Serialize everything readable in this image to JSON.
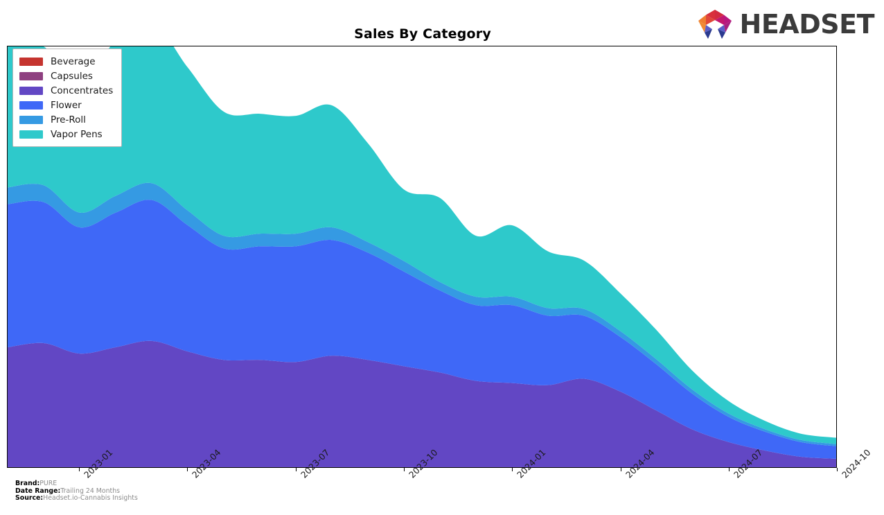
{
  "header": {
    "title": "Sales By Category",
    "logo_text": "HEADSET",
    "logo_icon": "headset-arch-logo"
  },
  "footnotes": [
    {
      "key": "Brand:",
      "value": "PURE"
    },
    {
      "key": "Date Range:",
      "value": "Trailing 24 Months"
    },
    {
      "key": "Source:",
      "value": "Headset.io-Cannabis Insights"
    }
  ],
  "legend": {
    "position": "top-left",
    "items": [
      {
        "label": "Beverage",
        "color": "#c5342f"
      },
      {
        "label": "Capsules",
        "color": "#8e4080"
      },
      {
        "label": "Concentrates",
        "color": "#6247c4"
      },
      {
        "label": "Flower",
        "color": "#3f68f7"
      },
      {
        "label": "Pre-Roll",
        "color": "#359ae3"
      },
      {
        "label": "Vapor Pens",
        "color": "#2ec9cb"
      }
    ]
  },
  "chart_data": {
    "type": "area",
    "title": "Sales By Category",
    "xlabel": "",
    "ylabel": "",
    "stacked": true,
    "grid": false,
    "legend_position": "upper left",
    "axis_tick_labels": [
      "2023-01",
      "2023-04",
      "2023-07",
      "2023-10",
      "2024-01",
      "2024-04",
      "2024-07",
      "2024-10"
    ],
    "x": [
      "2022-11",
      "2022-12",
      "2023-01",
      "2023-02",
      "2023-03",
      "2023-04",
      "2023-05",
      "2023-06",
      "2023-07",
      "2023-08",
      "2023-09",
      "2023-10",
      "2023-11",
      "2023-12",
      "2024-01",
      "2024-02",
      "2024-03",
      "2024-04",
      "2024-05",
      "2024-06",
      "2024-07",
      "2024-08",
      "2024-09",
      "2024-10"
    ],
    "ylim": [
      0,
      100
    ],
    "series": [
      {
        "name": "Beverage",
        "color": "#c5342f",
        "values": [
          0,
          0,
          0,
          0,
          0,
          0,
          0,
          0,
          0,
          0,
          0,
          0,
          0,
          0,
          0,
          0,
          0,
          0,
          0,
          0,
          0,
          0,
          0,
          0
        ]
      },
      {
        "name": "Capsules",
        "color": "#8e4080",
        "values": [
          0,
          0,
          0,
          0,
          0,
          0,
          0,
          0,
          0,
          0,
          0,
          0,
          0,
          0,
          0,
          0,
          0,
          0,
          0,
          0,
          0,
          0,
          0,
          0
        ]
      },
      {
        "name": "Concentrates",
        "color": "#6247c4",
        "values": [
          28.5,
          29.5,
          27.0,
          28.5,
          30.0,
          27.5,
          25.5,
          25.5,
          25.0,
          26.5,
          25.5,
          24.0,
          22.5,
          20.5,
          20.0,
          19.5,
          21.0,
          18.0,
          13.5,
          9.0,
          6.0,
          4.0,
          2.5,
          2.0
        ]
      },
      {
        "name": "Flower",
        "color": "#3f68f7",
        "values": [
          34.0,
          33.5,
          30.0,
          32.0,
          33.5,
          30.0,
          26.5,
          27.0,
          27.5,
          27.5,
          25.5,
          22.5,
          19.5,
          18.0,
          18.5,
          16.5,
          15.0,
          13.0,
          11.0,
          8.5,
          6.0,
          4.5,
          3.5,
          3.0
        ]
      },
      {
        "name": "Pre-Roll",
        "color": "#359ae3",
        "values": [
          4.0,
          4.0,
          3.5,
          4.0,
          4.0,
          3.5,
          3.0,
          3.0,
          3.0,
          3.0,
          2.5,
          2.5,
          2.0,
          2.0,
          2.0,
          1.8,
          1.6,
          1.4,
          1.2,
          1.0,
          0.8,
          0.6,
          0.5,
          0.5
        ]
      },
      {
        "name": "Vapor Pens",
        "color": "#2ec9cb",
        "values": [
          33.5,
          33.0,
          30.0,
          37.0,
          38.5,
          34.0,
          29.5,
          28.5,
          28.0,
          29.0,
          23.5,
          17.0,
          20.0,
          14.5,
          17.0,
          13.5,
          11.5,
          9.0,
          7.0,
          4.5,
          3.0,
          2.0,
          1.5,
          1.5
        ]
      }
    ]
  }
}
